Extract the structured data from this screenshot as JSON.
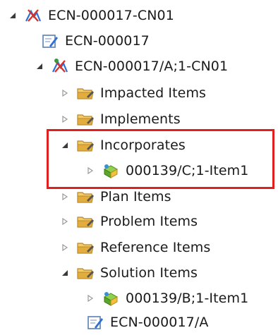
{
  "tree": {
    "items": [
      {
        "label": "ECN-000017-CN01",
        "icon": "change-notice-icon"
      },
      {
        "label": "ECN-000017",
        "icon": "document-edit-icon"
      },
      {
        "label": "ECN-000017/A;1-CN01",
        "icon": "change-notice-revision-icon"
      },
      {
        "label": "Impacted Items",
        "icon": "folder-icon"
      },
      {
        "label": "Implements",
        "icon": "folder-icon"
      },
      {
        "label": "Incorporates",
        "icon": "folder-icon"
      },
      {
        "label": "000139/C;1-Item1",
        "icon": "item-revision-icon"
      },
      {
        "label": "Plan Items",
        "icon": "folder-icon"
      },
      {
        "label": "Problem Items",
        "icon": "folder-icon"
      },
      {
        "label": "Reference Items",
        "icon": "folder-icon"
      },
      {
        "label": "Solution Items",
        "icon": "folder-icon"
      },
      {
        "label": "000139/B;1-Item1",
        "icon": "item-revision-icon"
      },
      {
        "label": "ECN-000017/A",
        "icon": "document-edit-icon"
      }
    ]
  },
  "colors": {
    "highlight": "#e0201c",
    "folder": "#d9a83a",
    "twisty_expanded": "#3a3a3a",
    "twisty_collapsed": "#9a9a9a"
  }
}
